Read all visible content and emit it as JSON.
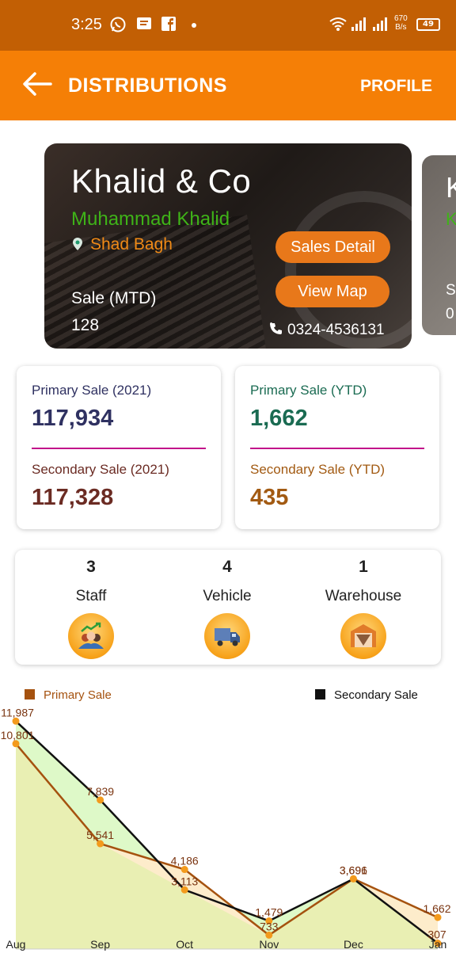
{
  "status_bar": {
    "time": "3:25",
    "network_speed_value": "670",
    "network_speed_unit": "B/s",
    "battery": "49",
    "icons": [
      "whatsapp-icon",
      "message-icon",
      "facebook-icon",
      "dot-icon",
      "wifi-icon",
      "signal-icon",
      "signal-icon",
      "battery-icon"
    ]
  },
  "app_bar": {
    "title": "DISTRIBUTIONS",
    "action": "PROFILE",
    "back_icon": "arrow-left-icon"
  },
  "distributor_card": {
    "company": "Khalid & Co",
    "owner": "Muhammad Khalid",
    "location": "Shad Bagh",
    "sale_label": "Sale (MTD)",
    "sale_value": "128",
    "sales_detail_button": "Sales Detail",
    "view_map_button": "View Map",
    "phone": "0324-4536131",
    "colors": {
      "owner": "#3fb318",
      "location": "#f08a16",
      "button": "#e8781a"
    }
  },
  "peek_card": {
    "initial": "K",
    "owner_initial": "K",
    "sale_label_initial": "S",
    "sale_value_initial": "0"
  },
  "stats": [
    {
      "primary_label": "Primary Sale (2021)",
      "primary_value": "117,934",
      "secondary_label": "Secondary Sale (2021)",
      "secondary_value": "117,328"
    },
    {
      "primary_label": "Primary Sale (YTD)",
      "primary_value": "1,662",
      "secondary_label": "Secondary Sale (YTD)",
      "secondary_value": "435"
    }
  ],
  "resources": [
    {
      "count": "3",
      "label": "Staff",
      "icon": "staff-growth-icon"
    },
    {
      "count": "4",
      "label": "Vehicle",
      "icon": "truck-icon"
    },
    {
      "count": "1",
      "label": "Warehouse",
      "icon": "warehouse-icon"
    }
  ],
  "chart_data": {
    "type": "area",
    "categories": [
      "Aug",
      "Sep",
      "Oct",
      "Nov",
      "Dec",
      "Jan"
    ],
    "series": [
      {
        "name": "Primary Sale",
        "values": [
          10801,
          5541,
          4186,
          733,
          3696,
          1662
        ],
        "color": "#a5520f"
      },
      {
        "name": "Secondary Sale",
        "values": [
          11987,
          7839,
          3113,
          1479,
          3691,
          307
        ],
        "color": "#111111"
      }
    ],
    "legend_position": "top",
    "ylim": [
      0,
      12000
    ],
    "grid": false,
    "point_color": "#f39a1c",
    "fill_colors": [
      "#e9efb3",
      "#fdeccb",
      "#def9c8"
    ]
  }
}
